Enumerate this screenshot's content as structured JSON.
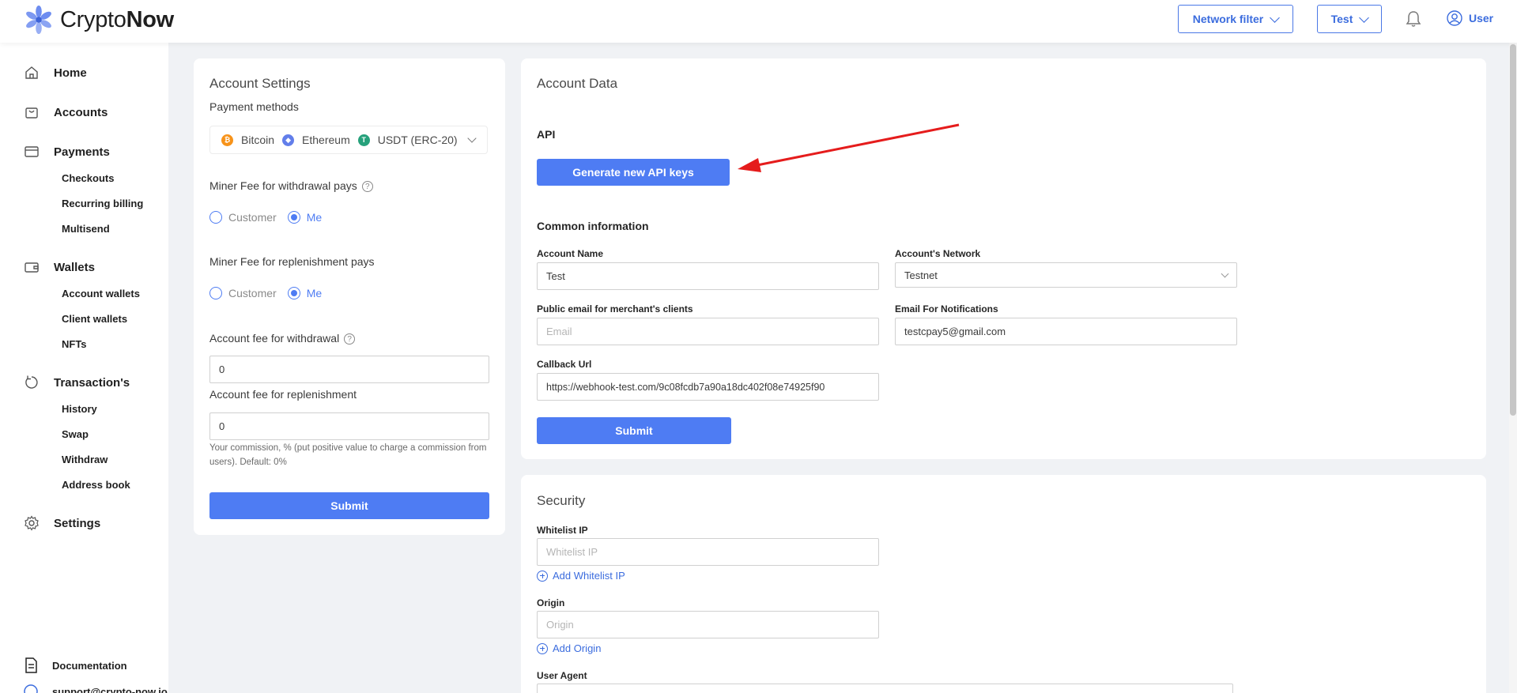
{
  "header": {
    "logo_light": "Crypto",
    "logo_bold": "Now",
    "network_filter": "Network filter",
    "account_switch": "Test",
    "user": "User",
    "icons": [
      "logo-flower-icon",
      "chevron-down-icon",
      "bell-icon",
      "user-circle-icon"
    ]
  },
  "sidebar": {
    "home": "Home",
    "accounts": "Accounts",
    "payments": "Payments",
    "payments_sub": [
      "Checkouts",
      "Recurring billing",
      "Multisend"
    ],
    "wallets": "Wallets",
    "wallets_sub": [
      "Account wallets",
      "Client wallets",
      "NFTs"
    ],
    "transactions": "Transaction's",
    "transactions_sub": [
      "History",
      "Swap",
      "Withdraw",
      "Address book"
    ],
    "settings": "Settings",
    "documentation": "Documentation",
    "support": "support@crypto-now.io"
  },
  "account_settings": {
    "title": "Account Settings",
    "payment_methods_label": "Payment methods",
    "payment_methods": [
      {
        "name": "Bitcoin",
        "color": "#f7931a",
        "glyph": "₿"
      },
      {
        "name": "Ethereum",
        "color": "#627eea",
        "glyph": "◆"
      },
      {
        "name": "USDT (ERC-20)",
        "color": "#26a17b",
        "glyph": "T"
      }
    ],
    "withdrawal_fee_label": "Miner Fee for withdrawal pays",
    "replenishment_fee_label": "Miner Fee for replenishment pays",
    "option_customer": "Customer",
    "option_me": "Me",
    "withdrawal_selected": "Me",
    "replenishment_selected": "Me",
    "account_fee_withdrawal_label": "Account fee for withdrawal",
    "account_fee_withdrawal_value": "0",
    "account_fee_replenishment_label": "Account fee for replenishment",
    "account_fee_replenishment_value": "0",
    "hint": "Your commission, % (put positive value to charge a commission from users). Default: 0%",
    "submit": "Submit"
  },
  "account_data": {
    "title": "Account Data",
    "api_label": "API",
    "generate_button": "Generate new API keys",
    "common_info": "Common information",
    "account_name_label": "Account Name",
    "account_name_value": "Test",
    "network_label": "Account's Network",
    "network_value": "Testnet",
    "public_email_label": "Public email for merchant's clients",
    "public_email_placeholder": "Email",
    "notify_email_label": "Email For Notifications",
    "notify_email_value": "testcpay5@gmail.com",
    "callback_label": "Callback Url",
    "callback_value": "https://webhook-test.com/9c08fcdb7a90a18dc402f08e74925f90",
    "submit": "Submit"
  },
  "security": {
    "title": "Security",
    "whitelist_label": "Whitelist IP",
    "whitelist_placeholder": "Whitelist IP",
    "add_whitelist": "Add Whitelist IP",
    "origin_label": "Origin",
    "origin_placeholder": "Origin",
    "add_origin": "Add Origin",
    "user_agent_label": "User Agent"
  },
  "annotation": {
    "arrow_color": "#e51c1c"
  }
}
